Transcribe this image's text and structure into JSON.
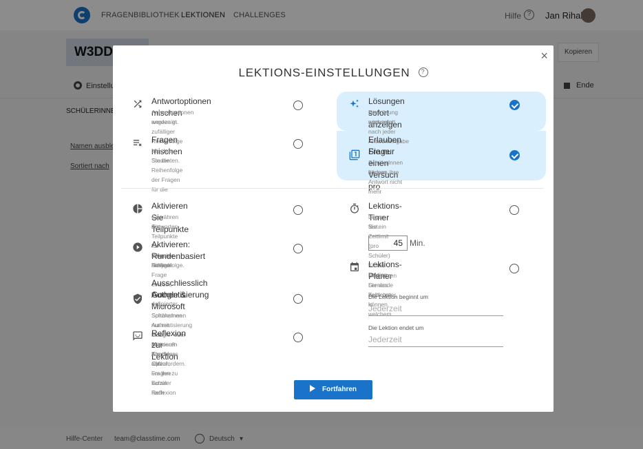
{
  "nav": {
    "items": [
      "FRAGENBIBLIOTHEK",
      "LEKTIONEN",
      "CHALLENGES"
    ],
    "help": "Hilfe",
    "help_glyph": "?",
    "user": "Jan Rihak"
  },
  "background": {
    "lesson_title": "W3DD",
    "copy": "Kopieren",
    "settings": "Einstellu",
    "end": "Ende",
    "students_tab": "SCHÜLERINNE",
    "hide_names": "Namen ausble",
    "sorted_by": "Sortiert nach"
  },
  "modal": {
    "title": "LEKTIONS-EINSTELLUNGEN",
    "help_glyph": "?",
    "close": "×",
    "settings": {
      "shuffle_answers": {
        "title": "Antwortoptionen mischen",
        "desc": [
          "Antwortoptionen werden in zufälliger Reihenfolge",
          "angezeigt."
        ],
        "icon": "shuffle-icon",
        "checked": false
      },
      "shuffle_questions": {
        "title": "Fragen mischen",
        "desc": [
          "Mischen Sie die Reihenfolge der Fragen für die",
          "Studenten."
        ],
        "icon": "playlist-shuffle-icon",
        "checked": false
      },
      "show_solutions": {
        "title": "Lösungen sofort anzeigen",
        "desc": [
          "Die Lösung wird sofort nach jeder Antworteingabe",
          "angezeigt."
        ],
        "icon": "sparkle-icon",
        "checked": true
      },
      "single_attempt": {
        "title": [
          "Erlauben Sie nur einen Versuch pro",
          "Frage"
        ],
        "desc": [
          "SchülerInnen können ihre Antwort nicht mehr",
          "ändern."
        ],
        "icon": "one-attempt-icon",
        "checked": true
      },
      "partial_points": {
        "title": "Aktivieren Sie Teilpunkte",
        "desc": [
          "Gewähren Sie Teilpunkte für teilweise richtige",
          "Antworten."
        ],
        "icon": "pie-chart-icon",
        "checked": false
      },
      "round_based": {
        "title": "Aktivieren: Rundenbasiert",
        "desc": [
          "Zeigen Sie jede Frage einzeln, in definierter",
          "Reihenfolge."
        ],
        "icon": "play-circle-icon",
        "checked": false
      },
      "google_ms_auth": {
        "title": [
          "Ausschliesslich Google & Microsoft",
          "Authentisierung"
        ],
        "desc": [
          "Keine Spitznamen. Authentisierung Ihrer",
          "SchülerInnen nur mit Google- oder Microsoft-Konto."
        ],
        "icon": "shield-check-icon",
        "checked": false
      },
      "reflection": {
        "title": "Reflexion zur Lektion",
        "desc": [
          "Aktivieren Sie diese Option, um Ihre Schüler nach",
          "Abschluss aller Fragen zu kurzer Reflexion",
          "aufzufordern."
        ],
        "icon": "comment-icon",
        "checked": false
      },
      "timer": {
        "title": "Lektions-Timer",
        "desc": [
          "Legen Sie ein Zeitlimit (pro Schüler) für die Lektion",
          "fest."
        ],
        "icon": "stopwatch-icon",
        "checked": false,
        "value": "45",
        "unit": "Min."
      },
      "planner": {
        "title": "Lektions-Planer",
        "desc": [
          "Begrenzen Sie das Zeitfenster, in welchem",
          "Lernende beitreten können."
        ],
        "icon": "calendar-icon",
        "checked": false,
        "start_label": "Die Lektion beginnt um",
        "start_placeholder": "Jederzeit",
        "end_label": "Die Lektion endet um",
        "end_placeholder": "Jederzeit"
      }
    },
    "continue": "Fortfahren"
  },
  "footer": {
    "help_center": "Hilfe-Center",
    "email": "team@classtime.com",
    "language": "Deutsch",
    "dropdown_glyph": "▾"
  },
  "colors": {
    "accent": "#1a73c8",
    "highlight": "#d9effd"
  }
}
